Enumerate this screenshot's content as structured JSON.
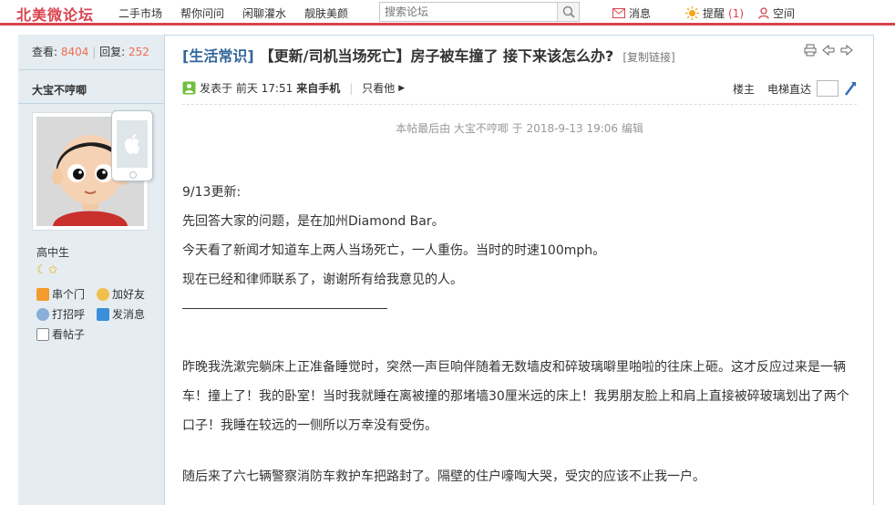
{
  "header": {
    "logo": "北美微论坛",
    "nav": [
      "二手市场",
      "帮你问问",
      "闲聊灌水",
      "靓肤美颜"
    ],
    "search_placeholder": "搜索论坛",
    "messages_label": "消息",
    "remind_label": "提醒",
    "remind_count": "(1)",
    "space_label": "空间",
    "accent_color": "#d9434f"
  },
  "sidebar": {
    "views_label": "查看:",
    "views": "8404",
    "replies_label": "回复:",
    "replies": "252",
    "author": "大宝不哼唧",
    "level": "高中生",
    "stars": "☾✩",
    "actions": [
      {
        "label": "串个门",
        "icon": "home-icon"
      },
      {
        "label": "加好友",
        "icon": "handshake-icon"
      },
      {
        "label": "打招呼",
        "icon": "greet-icon"
      },
      {
        "label": "发消息",
        "icon": "mail-icon"
      },
      {
        "label": "看帖子",
        "icon": "posts-icon"
      }
    ]
  },
  "thread": {
    "category": "[生活常识]",
    "title": "【更新/司机当场死亡】房子被车撞了 接下来该怎么办?",
    "copy_link": "[复制链接]"
  },
  "meta": {
    "posted": "发表于 前天 17:51",
    "source": "来自手机",
    "only_author": "只看他",
    "floor": "楼主",
    "jump_label": "电梯直达"
  },
  "edit_note": "本帖最后由 大宝不哼唧 于 2018-9-13 19:06 编辑",
  "post": {
    "update_heading": "9/13更新:",
    "update_lines": [
      "先回答大家的问题，是在加州Diamond Bar。",
      "今天看了新闻才知道车上两人当场死亡，一人重伤。当时的时速100mph。",
      "现在已经和律师联系了，谢谢所有给我意见的人。"
    ],
    "paragraph1": "昨晚我洗漱完躺床上正准备睡觉时，突然一声巨响伴随着无数墙皮和碎玻璃噼里啪啦的往床上砸。这才反应过来是一辆车！撞上了！我的卧室！当时我就睡在离被撞的那堵墙30厘米远的床上！我男朋友脸上和肩上直接被碎玻璃划出了两个口子！我睡在较远的一侧所以万幸没有受伤。",
    "paragraph2": "随后来了六七辆警察消防车救护车把路封了。隔壁的住户嚎啕大哭，受灾的应该不止我一户。"
  }
}
